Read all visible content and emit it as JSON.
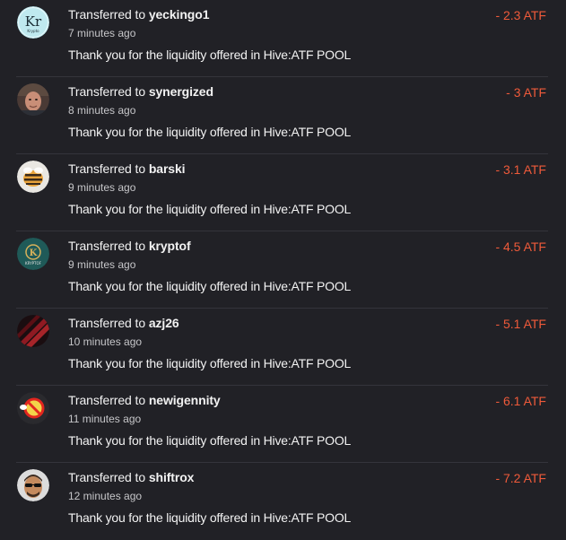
{
  "accent_color": "#ef5a3a",
  "transfers": [
    {
      "prefix": "Transferred to",
      "user": "yeckingo1",
      "time": "7 minutes ago",
      "memo": "Thank you for the liquidity offered in Hive:ATF POOL",
      "amount": "- 2.3 ATF",
      "avatar_icon": "kr-logo-icon",
      "avatar_text": "Kr",
      "avatar_subtext": "Krypto"
    },
    {
      "prefix": "Transferred to",
      "user": "synergized",
      "time": "8 minutes ago",
      "memo": "Thank you for the liquidity offered in Hive:ATF POOL",
      "amount": "- 3 ATF",
      "avatar_icon": "person-photo-icon"
    },
    {
      "prefix": "Transferred to",
      "user": "barski",
      "time": "9 minutes ago",
      "memo": "Thank you for the liquidity offered in Hive:ATF POOL",
      "amount": "- 3.1 ATF",
      "avatar_icon": "bee-icon"
    },
    {
      "prefix": "Transferred to",
      "user": "kryptof",
      "time": "9 minutes ago",
      "memo": "Thank you for the liquidity offered in Hive:ATF POOL",
      "amount": "- 4.5 ATF",
      "avatar_icon": "kryptof-logo-icon",
      "avatar_text": "K",
      "avatar_subtext": "KRYPTOF"
    },
    {
      "prefix": "Transferred to",
      "user": "azj26",
      "time": "10 minutes ago",
      "memo": "Thank you for the liquidity offered in Hive:ATF POOL",
      "amount": "- 5.1 ATF",
      "avatar_icon": "red-abstract-icon"
    },
    {
      "prefix": "Transferred to",
      "user": "newigennity",
      "time": "11 minutes ago",
      "memo": "Thank you for the liquidity offered in Hive:ATF POOL",
      "amount": "- 6.1 ATF",
      "avatar_icon": "no-sign-icon"
    },
    {
      "prefix": "Transferred to",
      "user": "shiftrox",
      "time": "12 minutes ago",
      "memo": "Thank you for the liquidity offered in Hive:ATF POOL",
      "amount": "- 7.2 ATF",
      "avatar_icon": "sunglasses-person-icon"
    }
  ]
}
